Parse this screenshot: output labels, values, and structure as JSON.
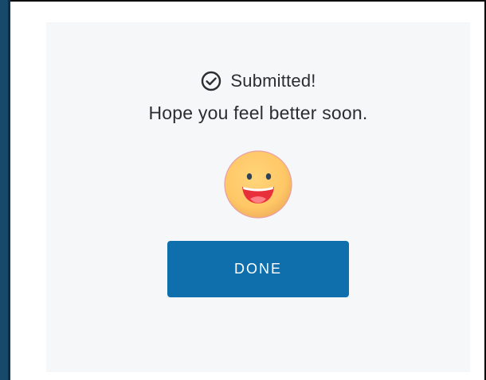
{
  "confirmation": {
    "status_icon": "check-circle-icon",
    "status_text": "Submitted!",
    "message": "Hope you feel better soon.",
    "emoji_icon": "smiling-face-icon",
    "done_label": "DONE"
  },
  "colors": {
    "accent": "#0f6fad",
    "card_background": "#f6f7f8",
    "side_bar": "#17496b",
    "emoji_face": "#ffc86a",
    "emoji_mouth": "#e8303a"
  }
}
